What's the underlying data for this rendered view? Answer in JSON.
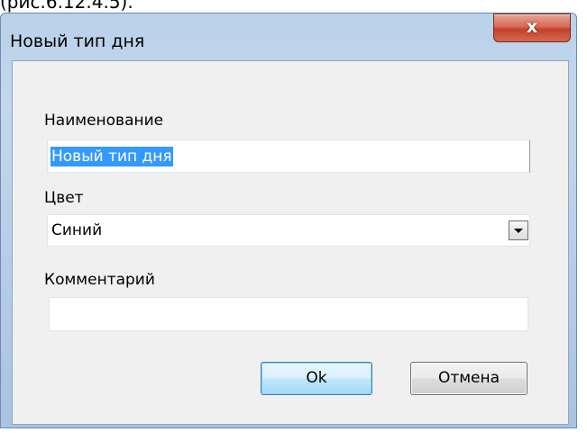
{
  "caption_fragment": "(рис.6.12.4.5).",
  "window": {
    "title": "Новый тип дня",
    "close_glyph": "x"
  },
  "form": {
    "name": {
      "label": "Наименование",
      "value": "Новый тип дня"
    },
    "color": {
      "label": "Цвет",
      "selected": "Синий"
    },
    "comment": {
      "label": "Комментарий",
      "value": ""
    }
  },
  "buttons": {
    "ok": "Ok",
    "cancel": "Отмена"
  },
  "icons": {
    "close": "close-icon",
    "dropdown": "chevron-down-icon"
  }
}
